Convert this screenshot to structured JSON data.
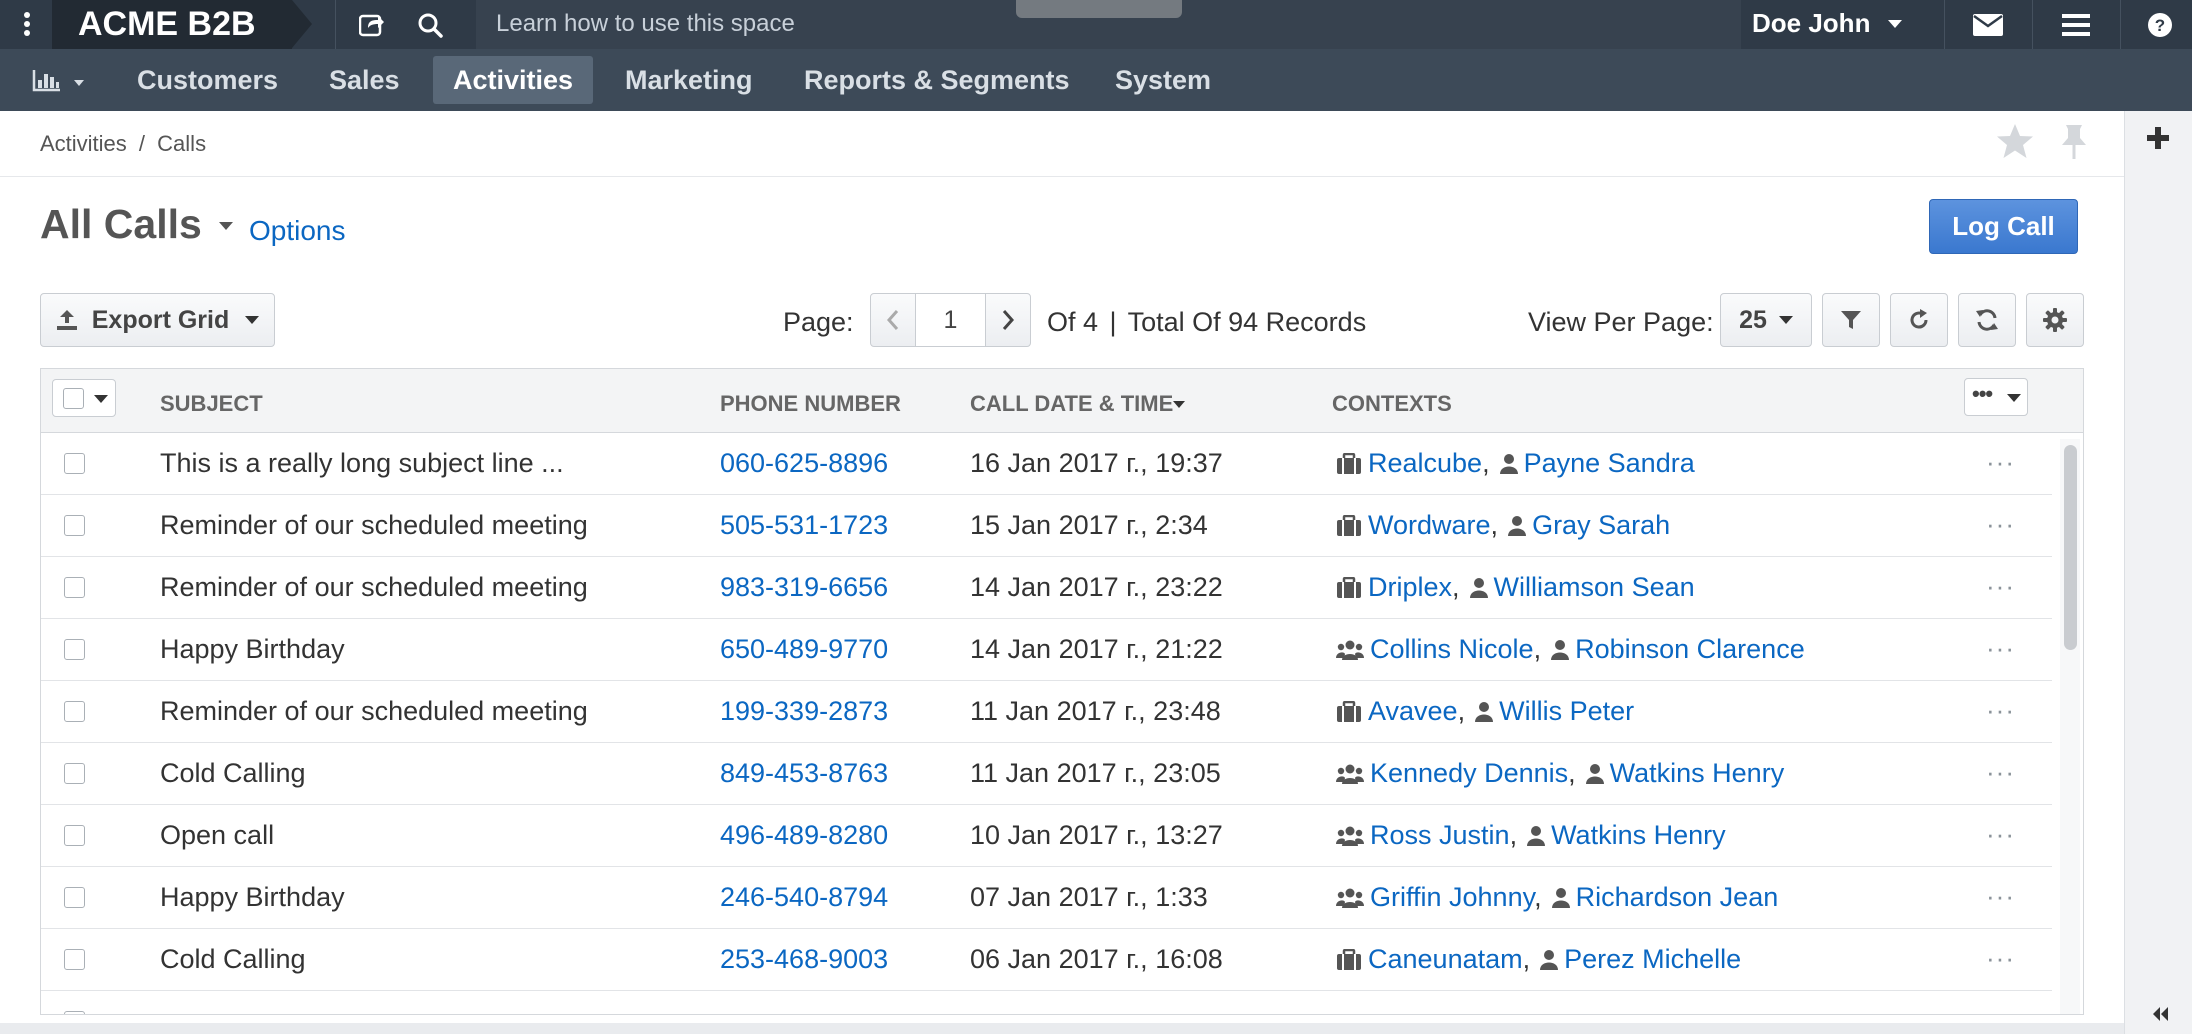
{
  "topbar": {
    "brand": "ACME B2B",
    "search_hint": "Learn how to use this space",
    "user_name": "Doe John"
  },
  "nav": {
    "items": [
      "Customers",
      "Sales",
      "Activities",
      "Marketing",
      "Reports & Segments",
      "System"
    ],
    "active": "Activities"
  },
  "breadcrumb": {
    "parent": "Activities",
    "separator": "/",
    "current": "Calls"
  },
  "page": {
    "title": "All Calls",
    "options_label": "Options",
    "log_call_label": "Log Call"
  },
  "toolbar": {
    "export_label": "Export Grid",
    "page_label": "Page:",
    "page_value": "1",
    "of_pages": "Of 4",
    "separator": "|",
    "total_records": "Total Of 94 Records",
    "view_per_page_label": "View Per Page:",
    "per_page_value": "25"
  },
  "grid": {
    "columns": [
      "SUBJECT",
      "PHONE NUMBER",
      "CALL DATE & TIME",
      "CONTEXTS"
    ],
    "sorted_column": "CALL DATE & TIME",
    "row_actions_glyph": "···",
    "rows": [
      {
        "subject": "This is a really long subject line ...",
        "phone": "060-625-8896",
        "datetime": "16 Jan 2017 г., 19:37",
        "ctx1_type": "account",
        "ctx1": "Realcube",
        "ctx2": "Payne Sandra"
      },
      {
        "subject": "Reminder of our scheduled meeting",
        "phone": "505-531-1723",
        "datetime": "15 Jan 2017 г., 2:34",
        "ctx1_type": "account",
        "ctx1": "Wordware",
        "ctx2": "Gray Sarah"
      },
      {
        "subject": "Reminder of our scheduled meeting",
        "phone": "983-319-6656",
        "datetime": "14 Jan 2017 г., 23:22",
        "ctx1_type": "account",
        "ctx1": "Driplex",
        "ctx2": "Williamson Sean"
      },
      {
        "subject": "Happy Birthday",
        "phone": "650-489-9770",
        "datetime": "14 Jan 2017 г., 21:22",
        "ctx1_type": "group",
        "ctx1": "Collins Nicole",
        "ctx2": "Robinson Clarence"
      },
      {
        "subject": "Reminder of our scheduled meeting",
        "phone": "199-339-2873",
        "datetime": "11 Jan 2017 г., 23:48",
        "ctx1_type": "account",
        "ctx1": "Avavee",
        "ctx2": "Willis Peter"
      },
      {
        "subject": "Cold Calling",
        "phone": "849-453-8763",
        "datetime": "11 Jan 2017 г., 23:05",
        "ctx1_type": "group",
        "ctx1": "Kennedy Dennis",
        "ctx2": "Watkins Henry"
      },
      {
        "subject": "Open call",
        "phone": "496-489-8280",
        "datetime": "10 Jan 2017 г., 13:27",
        "ctx1_type": "group",
        "ctx1": "Ross Justin",
        "ctx2": "Watkins Henry"
      },
      {
        "subject": "Happy Birthday",
        "phone": "246-540-8794",
        "datetime": "07 Jan 2017 г., 1:33",
        "ctx1_type": "group",
        "ctx1": "Griffin Johnny",
        "ctx2": "Richardson Jean"
      },
      {
        "subject": "Cold Calling",
        "phone": "253-468-9003",
        "datetime": "06 Jan 2017 г., 16:08",
        "ctx1_type": "account",
        "ctx1": "Caneunatam",
        "ctx2": "Perez Michelle"
      }
    ]
  },
  "colors": {
    "topbar": "#2f3a47",
    "navbar": "#3d4a58",
    "link": "#0b67c2",
    "primary_button": "#3a78cf"
  }
}
